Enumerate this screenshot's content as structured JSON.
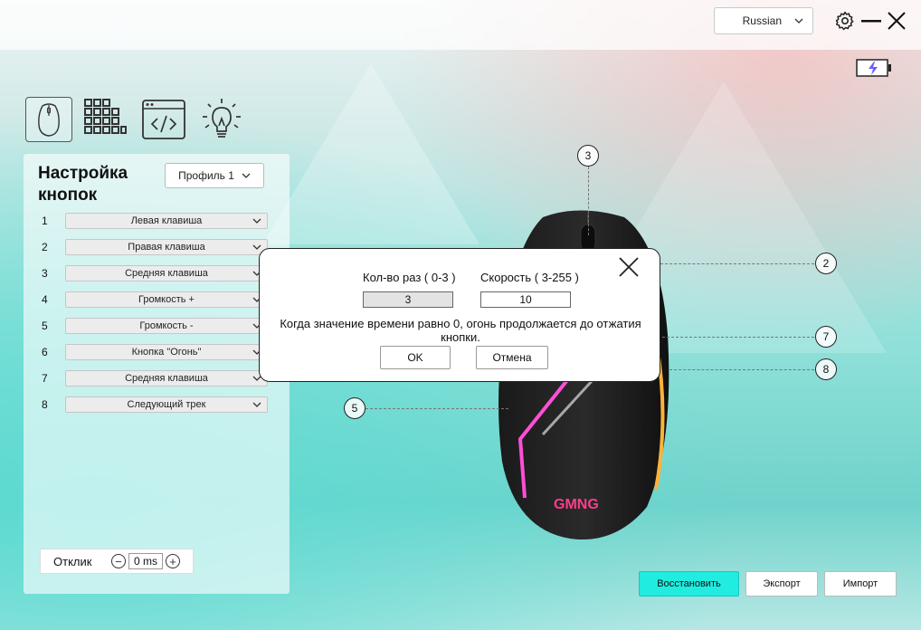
{
  "header": {
    "language": "Russian"
  },
  "icons": {
    "settings": "gear-icon",
    "minimize": "minimize-icon",
    "close": "close-icon",
    "battery": "battery-charging-icon"
  },
  "mode_tabs": [
    {
      "name": "mouse-tab",
      "icon": "mouse-icon",
      "active": true
    },
    {
      "name": "dpi-tab",
      "icon": "dpi-grid-icon"
    },
    {
      "name": "macro-tab",
      "icon": "code-icon"
    },
    {
      "name": "lighting-tab",
      "icon": "lightbulb-icon"
    }
  ],
  "panel": {
    "title": "Настройка кнопок",
    "profile": "Профиль 1",
    "buttons": [
      {
        "num": "1",
        "value": "Левая клавиша"
      },
      {
        "num": "2",
        "value": "Правая клавиша"
      },
      {
        "num": "3",
        "value": "Средняя клавиша"
      },
      {
        "num": "4",
        "value": "Громкость +"
      },
      {
        "num": "5",
        "value": "Громкость -"
      },
      {
        "num": "6",
        "value": "Кнопка \"Огонь\""
      },
      {
        "num": "7",
        "value": "Средняя клавиша"
      },
      {
        "num": "8",
        "value": "Следующий трек"
      }
    ],
    "response": {
      "label": "Отклик",
      "value": "0 ms",
      "minus": "−",
      "plus": "+"
    }
  },
  "callouts": {
    "c3": "3",
    "c2": "2",
    "c7": "7",
    "c8": "8",
    "c5": "5"
  },
  "mouse": {
    "brand": "GMNG"
  },
  "dialog": {
    "count_label": "Кол-во раз ( 0-3 )",
    "count_value": "3",
    "speed_label": "Скорость ( 3-255 )",
    "speed_value": "10",
    "message": "Когда значение времени равно 0, огонь продолжается до отжатия кнопки.",
    "ok": "OK",
    "cancel": "Отмена"
  },
  "footer": {
    "restore": "Восстановить",
    "export": "Экспорт",
    "import": "Импорт"
  },
  "colors": {
    "accent": "#20ece0",
    "battery": "#6a5cff"
  }
}
